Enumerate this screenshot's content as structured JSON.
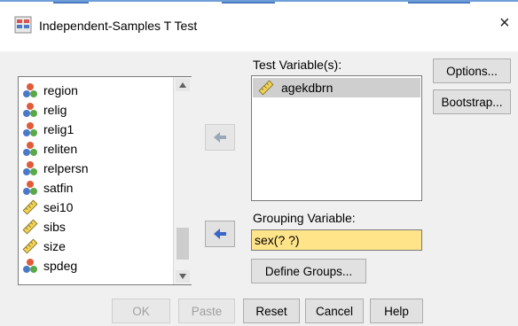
{
  "window": {
    "title": "Independent-Samples T Test",
    "close_glyph": "×"
  },
  "variable_list": {
    "items": [
      {
        "name": "region",
        "icon": "nominal-icon"
      },
      {
        "name": "relig",
        "icon": "nominal-icon"
      },
      {
        "name": "relig1",
        "icon": "nominal-icon"
      },
      {
        "name": "reliten",
        "icon": "nominal-icon"
      },
      {
        "name": "relpersn",
        "icon": "nominal-icon"
      },
      {
        "name": "satfin",
        "icon": "nominal-icon"
      },
      {
        "name": "sei10",
        "icon": "scale-icon"
      },
      {
        "name": "sibs",
        "icon": "scale-icon"
      },
      {
        "name": "size",
        "icon": "scale-icon"
      },
      {
        "name": "spdeg",
        "icon": "nominal-icon"
      }
    ]
  },
  "test_variables": {
    "label": "Test Variable(s):",
    "items": [
      {
        "name": "agekdbrn",
        "icon": "scale-icon"
      }
    ]
  },
  "grouping": {
    "label": "Grouping Variable:",
    "value": "sex(? ?)",
    "define_groups_label": "Define Groups..."
  },
  "side_buttons": {
    "options": "Options...",
    "bootstrap": "Bootstrap..."
  },
  "footer": {
    "ok": "OK",
    "paste": "Paste",
    "reset": "Reset",
    "cancel": "Cancel",
    "help": "Help"
  },
  "colors": {
    "accent_arrow": "#3b66c8",
    "grouping_field_bg": "#ffe48a",
    "selected_row": "#cfcfcf"
  }
}
